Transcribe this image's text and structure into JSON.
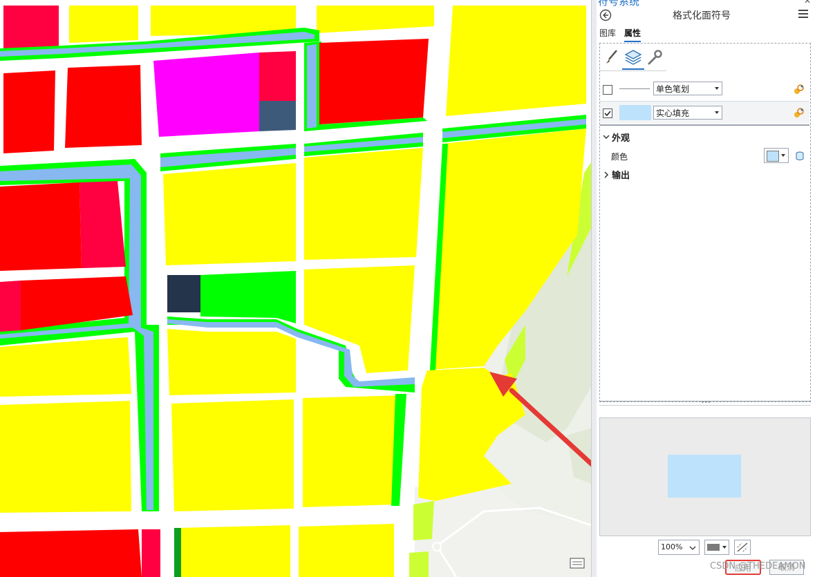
{
  "pane": {
    "header_title": "符号系统",
    "title": "格式化面符号",
    "tabs": [
      {
        "label": "图库",
        "active": false
      },
      {
        "label": "属性",
        "active": true
      }
    ],
    "tool_icons": [
      "brush-icon",
      "layers-icon",
      "wrench-icon"
    ],
    "layers": [
      {
        "checked": false,
        "symbol_type": "单色笔划",
        "swatch": "line"
      },
      {
        "checked": true,
        "symbol_type": "实心填充",
        "swatch": "#bde2fb"
      }
    ],
    "sections": [
      {
        "label": "外观",
        "expanded": true
      },
      {
        "label": "输出",
        "expanded": false
      }
    ],
    "color_label": "颜色",
    "color_value": "#bde2fb",
    "zoom_value": "100%",
    "buttons": {
      "apply": "应用",
      "cancel": "取消"
    },
    "watermark": "CSDN @THEDEAMON"
  },
  "colors": {
    "residential": "#ffff00",
    "commercial": "#ff0000",
    "commercial_alt": "#ff0040",
    "green_space": "#00ff00",
    "water": "#87b8f0",
    "admin": "#ff00ff",
    "industrial": "#3d5a7a",
    "basemap": "#e3e9da",
    "accent": "#1e6fc4",
    "highlight": "#e53935"
  }
}
